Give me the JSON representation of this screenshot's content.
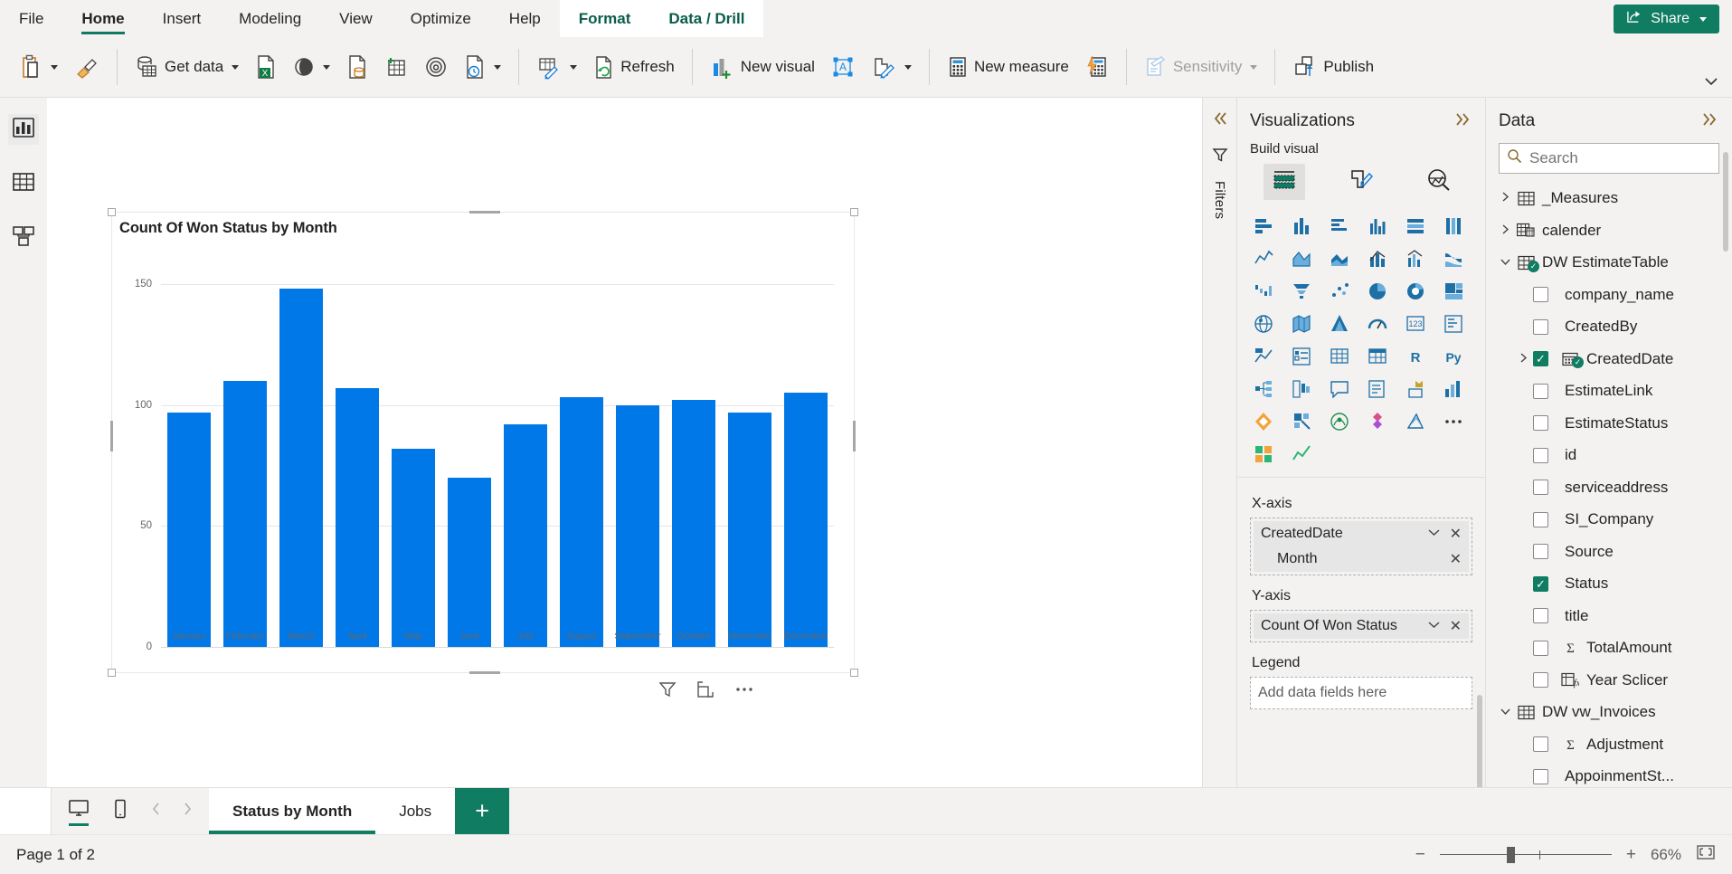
{
  "ribbon": {
    "tabs": [
      {
        "label": "File",
        "state": "normal"
      },
      {
        "label": "Home",
        "state": "active"
      },
      {
        "label": "Insert",
        "state": "normal"
      },
      {
        "label": "Modeling",
        "state": "normal"
      },
      {
        "label": "View",
        "state": "normal"
      },
      {
        "label": "Optimize",
        "state": "normal"
      },
      {
        "label": "Help",
        "state": "normal"
      },
      {
        "label": "Format",
        "state": "contextual"
      },
      {
        "label": "Data / Drill",
        "state": "contextual"
      }
    ],
    "share_label": "Share",
    "commands": [
      {
        "label": "",
        "icon": "paste-icon",
        "caret": true
      },
      {
        "label": "",
        "icon": "format-painter-icon",
        "caret": false
      },
      {
        "label": "Get data",
        "icon": "get-data-icon",
        "caret": true
      },
      {
        "label": "",
        "icon": "excel-workbook-icon",
        "caret": false
      },
      {
        "label": "",
        "icon": "dataverse-icon",
        "caret": true
      },
      {
        "label": "",
        "icon": "sql-server-icon",
        "caret": false
      },
      {
        "label": "",
        "icon": "enter-data-icon",
        "caret": false
      },
      {
        "label": "",
        "icon": "dataflows-icon",
        "caret": false
      },
      {
        "label": "",
        "icon": "recent-sources-icon",
        "caret": true
      },
      {
        "label": "",
        "icon": "transform-data-icon",
        "caret": true
      },
      {
        "label": "Refresh",
        "icon": "refresh-icon",
        "caret": false
      },
      {
        "label": "New visual",
        "icon": "new-visual-icon",
        "caret": false
      },
      {
        "label": "",
        "icon": "text-box-icon",
        "caret": false
      },
      {
        "label": "",
        "icon": "more-visuals-icon",
        "caret": true
      },
      {
        "label": "New measure",
        "icon": "new-measure-icon",
        "caret": false
      },
      {
        "label": "",
        "icon": "quick-measure-icon",
        "caret": false
      },
      {
        "label": "Sensitivity",
        "icon": "sensitivity-icon",
        "caret": true,
        "disabled": true
      },
      {
        "label": "Publish",
        "icon": "publish-icon",
        "caret": false
      }
    ]
  },
  "rail": {
    "items": [
      {
        "name": "report-view-icon",
        "label": "Report view",
        "active": true
      },
      {
        "name": "table-view-icon",
        "label": "Table view",
        "active": false
      },
      {
        "name": "model-view-icon",
        "label": "Model view",
        "active": false
      }
    ]
  },
  "visual": {
    "title": "Count Of Won Status by Month",
    "footer_icons": [
      "filter-icon",
      "focus-mode-icon",
      "more-options-icon"
    ]
  },
  "chart_data": {
    "type": "bar",
    "title": "Count Of Won Status by Month",
    "xlabel": "",
    "ylabel": "",
    "ylim": [
      0,
      160
    ],
    "grid": true,
    "legend": "none",
    "yticks": [
      0,
      50,
      100,
      150
    ],
    "categories": [
      "January",
      "February",
      "March",
      "April",
      "May",
      "June",
      "July",
      "August",
      "September",
      "October",
      "November",
      "December"
    ],
    "values": [
      97,
      110,
      148,
      107,
      82,
      70,
      92,
      103,
      100,
      102,
      97,
      105
    ],
    "series": [
      {
        "name": "Count Of Won Status",
        "color": "#0078e7",
        "values": [
          97,
          110,
          148,
          107,
          82,
          70,
          92,
          103,
          100,
          102,
          97,
          105
        ]
      }
    ]
  },
  "filters": {
    "label": "Filters",
    "collapse_icon": "double-chevron-left-icon",
    "expand_icon": "filter-pane-icon"
  },
  "visualizations": {
    "title": "Visualizations",
    "expand_icon": "double-chevron-right-icon",
    "build_label": "Build visual",
    "build_tabs": [
      {
        "name": "fields-tab",
        "icon": "build-fields-icon",
        "active": true
      },
      {
        "name": "format-tab",
        "icon": "paint-brush-icon",
        "active": false
      },
      {
        "name": "analytics-tab",
        "icon": "analytics-magnifier-icon",
        "active": false
      }
    ],
    "gallery_rows": [
      [
        "stacked-bar-chart-icon",
        "stacked-column-chart-icon",
        "clustered-bar-chart-icon",
        "clustered-column-chart-icon",
        "100-stacked-bar-chart-icon",
        "100-stacked-column-chart-icon"
      ],
      [
        "line-chart-icon",
        "area-chart-icon",
        "stacked-area-chart-icon",
        "line-stacked-column-icon",
        "line-clustered-column-icon",
        "ribbon-chart-icon"
      ],
      [
        "waterfall-chart-icon",
        "funnel-chart-icon",
        "scatter-chart-icon",
        "pie-chart-icon",
        "donut-chart-icon",
        "treemap-icon"
      ],
      [
        "map-icon",
        "filled-map-icon",
        "azure-map-icon",
        "gauge-icon",
        "card-icon",
        "multi-row-card-icon"
      ],
      [
        "kpi-icon",
        "slicer-icon",
        "table-icon",
        "matrix-icon",
        "r-script-visual-icon",
        "python-visual-icon"
      ],
      [
        "decomposition-tree-icon",
        "key-influencers-icon",
        "q-and-a-icon",
        "smart-narrative-icon",
        "paginated-report-icon",
        "metrics-icon"
      ],
      [
        "power-apps-icon",
        "power-automate-icon",
        "arcgis-map-icon",
        "scorecard-icon",
        "azure-ml-icon",
        "more-visuals-ellipsis-icon"
      ],
      [
        "build-your-own-visual-icon",
        "get-more-visuals-icon"
      ]
    ],
    "wells": [
      {
        "label": "X-axis",
        "fields": [
          {
            "name": "CreatedDate",
            "has_caret": true,
            "has_remove": true,
            "sub": false
          },
          {
            "name": "Month",
            "has_caret": false,
            "has_remove": true,
            "sub": true
          }
        ]
      },
      {
        "label": "Y-axis",
        "fields": [
          {
            "name": "Count Of Won Status",
            "has_caret": true,
            "has_remove": true,
            "sub": false
          }
        ]
      },
      {
        "label": "Legend",
        "fields": [],
        "placeholder": "Add data fields here"
      }
    ]
  },
  "data_pane": {
    "title": "Data",
    "expand_icon": "double-chevron-right-icon",
    "search": {
      "placeholder": "Search",
      "value": "",
      "icon": "search-icon"
    },
    "items": [
      {
        "label": "_Measures",
        "type": "table",
        "icon": "table-icon",
        "expandable": true,
        "expanded": false,
        "checked": false,
        "level": 0,
        "badge": false
      },
      {
        "label": "calender",
        "type": "table",
        "icon": "date-table-icon",
        "expandable": true,
        "expanded": false,
        "checked": false,
        "level": 0,
        "badge": false
      },
      {
        "label": "DW EstimateTable",
        "type": "table",
        "icon": "table-icon",
        "expandable": true,
        "expanded": true,
        "checked": false,
        "level": 0,
        "badge": true
      },
      {
        "label": "company_name",
        "type": "field",
        "icon": "",
        "expandable": false,
        "expanded": false,
        "checked": false,
        "level": 1,
        "badge": false
      },
      {
        "label": "CreatedBy",
        "type": "field",
        "icon": "",
        "expandable": false,
        "expanded": false,
        "checked": false,
        "level": 1,
        "badge": false
      },
      {
        "label": "CreatedDate",
        "type": "date-field",
        "icon": "calendar-icon",
        "expandable": true,
        "expanded": false,
        "checked": true,
        "level": 1,
        "badge": true
      },
      {
        "label": "EstimateLink",
        "type": "field",
        "icon": "",
        "expandable": false,
        "expanded": false,
        "checked": false,
        "level": 1,
        "badge": false
      },
      {
        "label": "EstimateStatus",
        "type": "field",
        "icon": "",
        "expandable": false,
        "expanded": false,
        "checked": false,
        "level": 1,
        "badge": false
      },
      {
        "label": "id",
        "type": "field",
        "icon": "",
        "expandable": false,
        "expanded": false,
        "checked": false,
        "level": 1,
        "badge": false
      },
      {
        "label": "serviceaddress",
        "type": "field",
        "icon": "",
        "expandable": false,
        "expanded": false,
        "checked": false,
        "level": 1,
        "badge": false
      },
      {
        "label": "SI_Company",
        "type": "field",
        "icon": "",
        "expandable": false,
        "expanded": false,
        "checked": false,
        "level": 1,
        "badge": false
      },
      {
        "label": "Source",
        "type": "field",
        "icon": "",
        "expandable": false,
        "expanded": false,
        "checked": false,
        "level": 1,
        "badge": false
      },
      {
        "label": "Status",
        "type": "field",
        "icon": "",
        "expandable": false,
        "expanded": false,
        "checked": true,
        "level": 1,
        "badge": false
      },
      {
        "label": "title",
        "type": "field",
        "icon": "",
        "expandable": false,
        "expanded": false,
        "checked": false,
        "level": 1,
        "badge": false
      },
      {
        "label": "TotalAmount",
        "type": "measure-sum",
        "icon": "sigma-icon",
        "expandable": false,
        "expanded": false,
        "checked": false,
        "level": 1,
        "badge": false
      },
      {
        "label": "Year Sclicer",
        "type": "calculated-field",
        "icon": "fx-icon",
        "expandable": false,
        "expanded": false,
        "checked": false,
        "level": 1,
        "badge": false
      },
      {
        "label": "DW vw_Invoices",
        "type": "table",
        "icon": "table-icon",
        "expandable": true,
        "expanded": true,
        "checked": false,
        "level": 0,
        "badge": false
      },
      {
        "label": "Adjustment",
        "type": "measure-sum",
        "icon": "sigma-icon",
        "expandable": false,
        "expanded": false,
        "checked": false,
        "level": 1,
        "badge": false
      },
      {
        "label": "AppoinmentSt...",
        "type": "field",
        "icon": "",
        "expandable": false,
        "expanded": false,
        "checked": false,
        "level": 1,
        "badge": false
      }
    ]
  },
  "page_bar": {
    "desktop_icon": "desktop-layout-icon",
    "mobile_icon": "mobile-layout-icon",
    "prev_icon": "prev-page-icon",
    "next_icon": "next-page-icon",
    "tabs": [
      {
        "label": "Status by Month",
        "active": true
      },
      {
        "label": "Jobs",
        "active": false
      }
    ],
    "add_label": "+"
  },
  "status_bar": {
    "page_text": "Page 1 of 2",
    "zoom_minus": "−",
    "zoom_plus": "+",
    "zoom_level": "66%",
    "fit_icon": "fit-to-page-icon"
  },
  "colors": {
    "accent": "#107c62",
    "bar": "#0078e7",
    "ribbon_bg": "#f3f2f1",
    "contextual_tab": "#0b5c4c"
  }
}
